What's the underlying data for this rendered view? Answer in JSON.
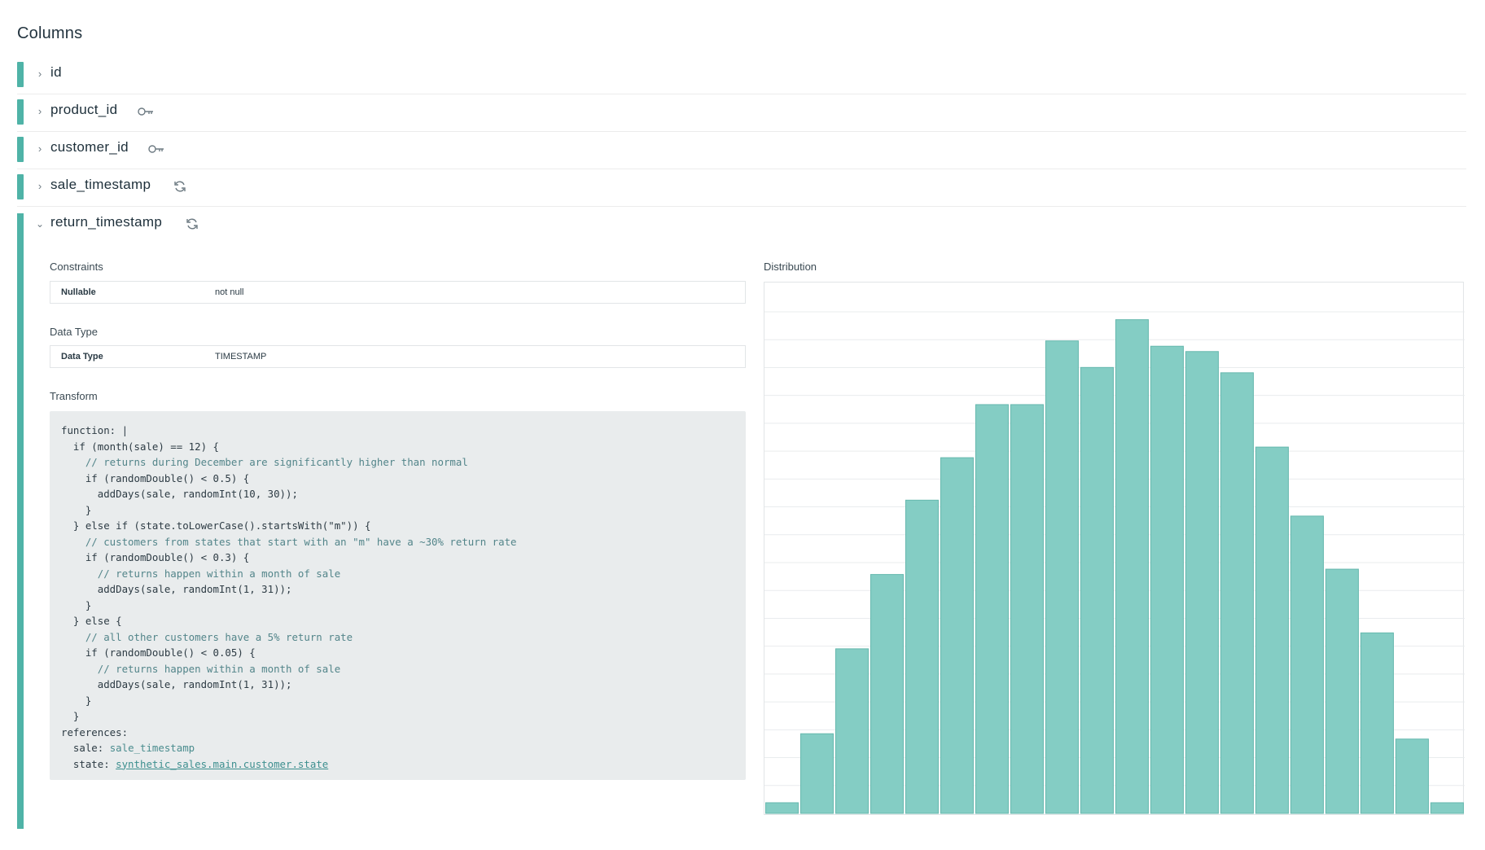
{
  "section_title": "Columns",
  "columns": [
    {
      "name": "id",
      "icon": null,
      "expanded": false
    },
    {
      "name": "product_id",
      "icon": "key-icon",
      "expanded": false
    },
    {
      "name": "customer_id",
      "icon": "key-icon",
      "expanded": false
    },
    {
      "name": "sale_timestamp",
      "icon": "refresh-icon",
      "expanded": false
    },
    {
      "name": "return_timestamp",
      "icon": "refresh-icon",
      "expanded": true
    }
  ],
  "detail": {
    "constraints_label": "Constraints",
    "constraints": {
      "key": "Nullable",
      "value": "not null"
    },
    "data_type_label": "Data Type",
    "data_type": {
      "key": "Data Type",
      "value": "TIMESTAMP"
    },
    "transform_label": "Transform",
    "code": {
      "l1": "function: |",
      "l2": "  if (month(sale) == 12) {",
      "l3": "    // returns during December are significantly higher than normal",
      "l4": "    if (randomDouble() < 0.5) {",
      "l5": "      addDays(sale, randomInt(10, 30));",
      "l6": "    }",
      "l7": "  } else if (state.toLowerCase().startsWith(\"m\")) {",
      "l8": "    // customers from states that start with an \"m\" have a ~30% return rate",
      "l9": "    if (randomDouble() < 0.3) {",
      "l10": "      // returns happen within a month of sale",
      "l11": "      addDays(sale, randomInt(1, 31));",
      "l12": "    }",
      "l13": "  } else {",
      "l14": "    // all other customers have a 5% return rate",
      "l15": "    if (randomDouble() < 0.05) {",
      "l16": "      // returns happen within a month of sale",
      "l17": "      addDays(sale, randomInt(1, 31));",
      "l18": "    }",
      "l19": "  }",
      "l20": "references:",
      "l21_key": "  sale: ",
      "l21_val": "sale_timestamp",
      "l22_key": "  state: ",
      "l22_val": "synthetic_sales.main.customer.state"
    },
    "distribution_label": "Distribution"
  },
  "chart_data": {
    "type": "bar",
    "title": "",
    "xlabel": "",
    "ylabel": "",
    "grid": true,
    "bar_color": "#84cdc4",
    "bar_stroke": "#66b8ae",
    "values": [
      2,
      15,
      31,
      45,
      59,
      67,
      77,
      77,
      89,
      84,
      93,
      88,
      87,
      83,
      69,
      56,
      46,
      34,
      14,
      2
    ],
    "ylim": [
      0,
      100
    ]
  }
}
